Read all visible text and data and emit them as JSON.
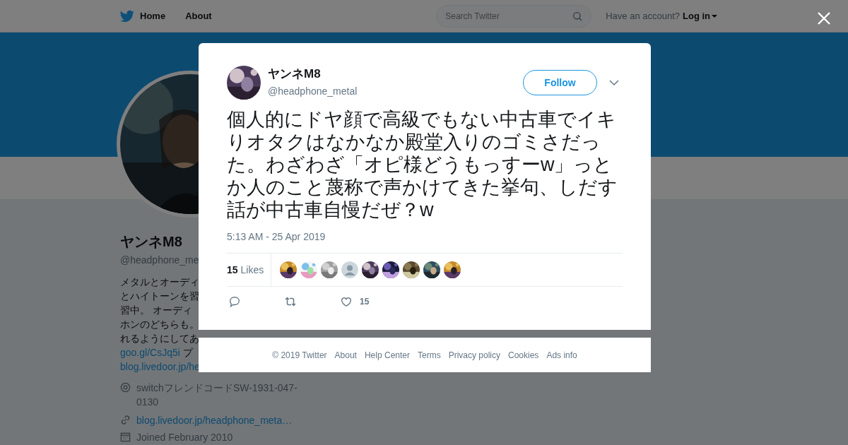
{
  "nav": {
    "items": [
      "Home",
      "About"
    ],
    "search": {
      "placeholder": "Search Twitter"
    },
    "account_prompt": "Have an account?",
    "login": "Log in"
  },
  "profile": {
    "name": "ヤンネM8",
    "handle": "@headphone_me",
    "bio_lines": [
      "メタルとオーディ",
      "とハイトーンを習",
      "習中。 オーディ",
      "ホンのどちらも。",
      "れるようにしてあ"
    ],
    "bio_links": [
      {
        "link": "goo.gl/CsJq5i",
        "rest": "プ"
      },
      {
        "link": "blog.livedoor.jp/he"
      }
    ],
    "location": "switchフレンドコードSW-1931-047-0130",
    "website": "blog.livedoor.jp/headphone_meta…",
    "joined": "Joined February 2010"
  },
  "tweet": {
    "name": "ヤンネM8",
    "handle": "@headphone_metal",
    "follow": "Follow",
    "text": "個人的にドヤ顔で高級でもない中古車でイキりオタクはなかなか殿堂入りのゴミさだった。わざわざ「オピ様どうもっすーw」っとか人のこと蔑称で声かけてきた挙句、しだす話が中古車自慢だぜ？w",
    "time": "5:13 AM - 25 Apr 2019",
    "likes_count": "15",
    "likes_label": "Likes",
    "liker_avatars": [
      {
        "kind": "picture"
      },
      {
        "kind": "picture"
      },
      {
        "kind": "picture"
      },
      {
        "kind": "default"
      },
      {
        "kind": "picture"
      },
      {
        "kind": "picture"
      },
      {
        "kind": "picture"
      },
      {
        "kind": "picture"
      },
      {
        "kind": "picture"
      }
    ],
    "like_action_count": "15"
  },
  "footer": [
    "© 2019 Twitter",
    "About",
    "Help Center",
    "Terms",
    "Privacy policy",
    "Cookies",
    "Ads info"
  ]
}
